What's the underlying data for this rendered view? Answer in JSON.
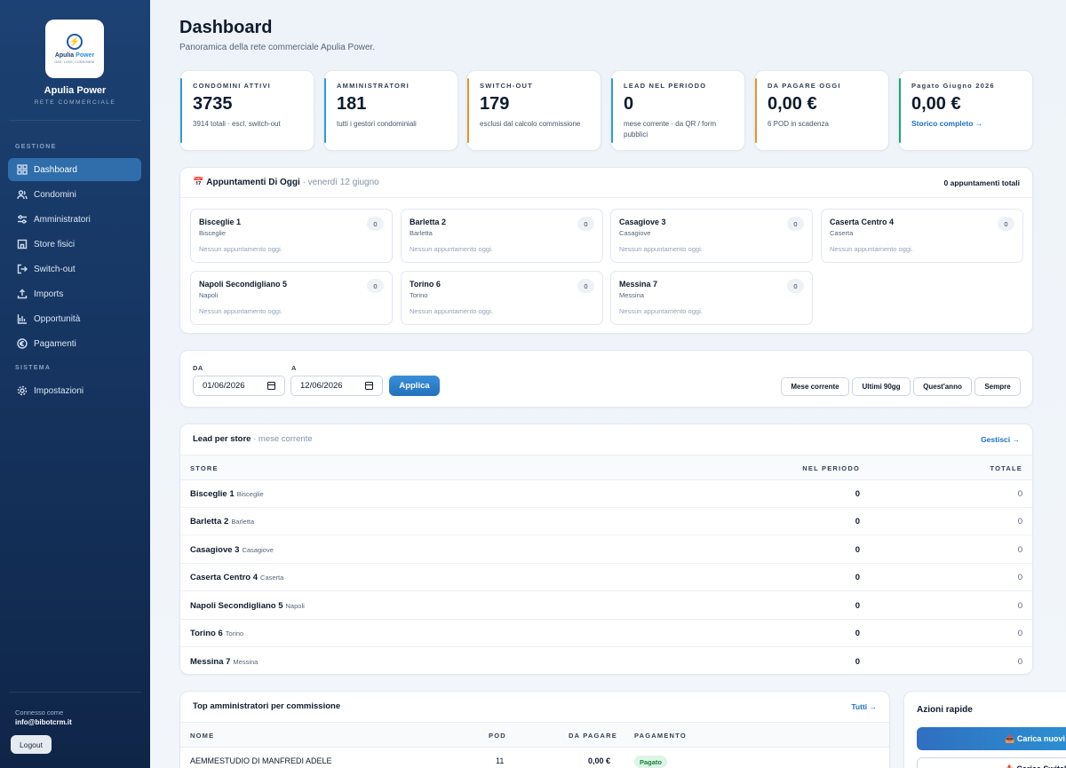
{
  "sidebar": {
    "logo": {
      "brand_a": "Apulia",
      "brand_b": "Power",
      "tagline": "GAS, LUCE, CONDOMINI"
    },
    "brand_name": "Apulia Power",
    "brand_sub": "RETE COMMERCIALE",
    "section_gestione": "GESTIONE",
    "section_sistema": "SISTEMA",
    "items": [
      {
        "label": "Dashboard",
        "icon": "grid-icon",
        "active": true
      },
      {
        "label": "Condomini",
        "icon": "users-icon"
      },
      {
        "label": "Amministratori",
        "icon": "sliders-icon"
      },
      {
        "label": "Store fisici",
        "icon": "store-icon"
      },
      {
        "label": "Switch-out",
        "icon": "logout-arrow-icon"
      },
      {
        "label": "Imports",
        "icon": "upload-icon"
      },
      {
        "label": "Opportunità",
        "icon": "bar-chart-icon"
      },
      {
        "label": "Pagamenti",
        "icon": "euro-icon"
      }
    ],
    "settings_label": "Impostazioni",
    "connected_as": "Connesso come",
    "email": "info@bibotcrm.it",
    "logout": "Logout"
  },
  "header": {
    "title": "Dashboard",
    "subtitle": "Panoramica della rete commerciale Apulia Power."
  },
  "accent_colors": {
    "blue": "#2f9ad6",
    "orange": "#e0962c",
    "green": "#1fa57a"
  },
  "stats": [
    {
      "label": "CONDOMINI ATTIVI",
      "value": "3735",
      "sub": "3914 totali · escl. switch-out"
    },
    {
      "label": "AMMINISTRATORI",
      "value": "181",
      "sub": "tutti i gestori condominiali"
    },
    {
      "label": "SWITCH-OUT",
      "value": "179",
      "sub": "esclusi dal calcolo commissione"
    },
    {
      "label": "LEAD NEL PERIODO",
      "value": "0",
      "sub": "mese corrente · da QR / form pubblici"
    },
    {
      "label": "DA PAGARE OGGI",
      "value": "0,00 €",
      "sub": "6 POD in scadenza"
    },
    {
      "label": "Pagato Giugno 2026",
      "value": "0,00 €",
      "link": "Storico completo →"
    }
  ],
  "appointments": {
    "icon": "📅",
    "title": "Appuntamenti Di Oggi",
    "date": "· venerdì 12 giugno",
    "total": "0 appuntamenti totali",
    "empty_text": "Nessun appuntamento oggi.",
    "stores": [
      {
        "name": "Bisceglie 1",
        "city": "Bisceglie",
        "count": "0"
      },
      {
        "name": "Barletta 2",
        "city": "Barletta",
        "count": "0"
      },
      {
        "name": "Casagiove 3",
        "city": "Casagiove",
        "count": "0"
      },
      {
        "name": "Caserta Centro 4",
        "city": "Caserta",
        "count": "0"
      },
      {
        "name": "Napoli Secondigliano 5",
        "city": "Napoli",
        "count": "0"
      },
      {
        "name": "Torino 6",
        "city": "Torino",
        "count": "0"
      },
      {
        "name": "Messina 7",
        "city": "Messina",
        "count": "0"
      }
    ]
  },
  "filters": {
    "from_label": "DA",
    "to_label": "A",
    "from_value": "01/06/2026",
    "to_value": "12/06/2026",
    "apply": "Applica",
    "ranges": [
      "Mese corrente",
      "Ultimi 90gg",
      "Quest'anno",
      "Sempre"
    ]
  },
  "lead_table": {
    "title": "Lead per store",
    "period": "· mese corrente",
    "manage": "Gestisci →",
    "columns": {
      "store": "STORE",
      "period": "NEL PERIODO",
      "total": "TOTALE"
    },
    "rows": [
      {
        "store": "Bisceglie 1",
        "city": "Bisceglie",
        "period": "0",
        "total": "0"
      },
      {
        "store": "Barletta 2",
        "city": "Barletta",
        "period": "0",
        "total": "0"
      },
      {
        "store": "Casagiove 3",
        "city": "Casagiove",
        "period": "0",
        "total": "0"
      },
      {
        "store": "Caserta Centro 4",
        "city": "Caserta",
        "period": "0",
        "total": "0"
      },
      {
        "store": "Napoli Secondigliano 5",
        "city": "Napoli",
        "period": "0",
        "total": "0"
      },
      {
        "store": "Torino 6",
        "city": "Torino",
        "period": "0",
        "total": "0"
      },
      {
        "store": "Messina 7",
        "city": "Messina",
        "period": "0",
        "total": "0"
      }
    ]
  },
  "top_admins": {
    "title": "Top amministratori per commissione",
    "all": "Tutti →",
    "columns": {
      "name": "NOME",
      "pod": "POD",
      "due": "DA PAGARE",
      "payment": "PAGAMENTO"
    },
    "rows": [
      {
        "name": "AEMMESTUDIO DI MANFREDI ADELE",
        "pod": "11",
        "due": "0,00 €",
        "payment": "Pagato"
      }
    ]
  },
  "quick_actions": {
    "title": "Azioni rapide",
    "primary": "📤 Carica nuovi PDP",
    "secondary": "📤 Carica Switch-out"
  }
}
